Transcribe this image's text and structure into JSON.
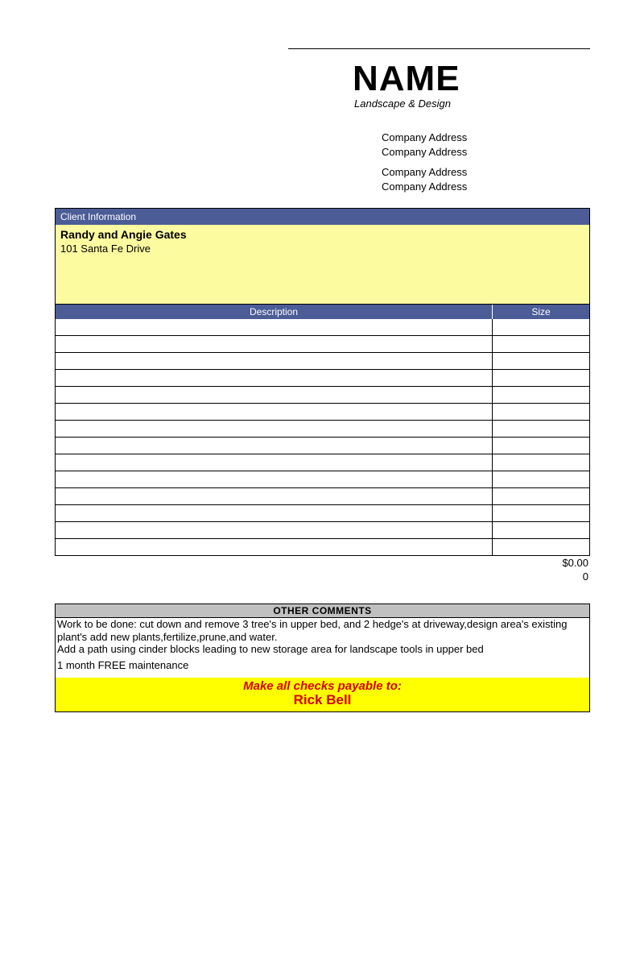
{
  "header": {
    "company_name": "NAME",
    "tagline": "Landscape & Design",
    "address_lines": [
      "Company Address",
      "Company Address",
      "Company Address",
      "Company Address"
    ]
  },
  "client_section": {
    "title": "Client Information",
    "name": "Randy and Angie Gates",
    "address": "101 Santa Fe Drive"
  },
  "table": {
    "col_description": "Description",
    "col_size": "Size",
    "rows": [
      {
        "description": "",
        "size": ""
      },
      {
        "description": "",
        "size": ""
      },
      {
        "description": "",
        "size": ""
      },
      {
        "description": "",
        "size": ""
      },
      {
        "description": "",
        "size": ""
      },
      {
        "description": "",
        "size": ""
      },
      {
        "description": "",
        "size": ""
      },
      {
        "description": "",
        "size": ""
      },
      {
        "description": "",
        "size": ""
      },
      {
        "description": "",
        "size": ""
      },
      {
        "description": "",
        "size": ""
      },
      {
        "description": "",
        "size": ""
      },
      {
        "description": "",
        "size": ""
      },
      {
        "description": "",
        "size": ""
      }
    ],
    "total_amount": "$0.00",
    "total_qty": "0"
  },
  "comments": {
    "title": "OTHER COMMENTS",
    "line1": "Work to be done: cut down and remove 3 tree's in upper bed, and 2 hedge's at driveway,design area's existing plant's add new plants,fertilize,prune,and water.",
    "line2": "Add a path using cinder blocks leading to new storage area for landscape tools in upper bed",
    "line3": "1 month FREE maintenance"
  },
  "payable": {
    "label": "Make all checks payable to:",
    "payee": "Rick Bell"
  }
}
